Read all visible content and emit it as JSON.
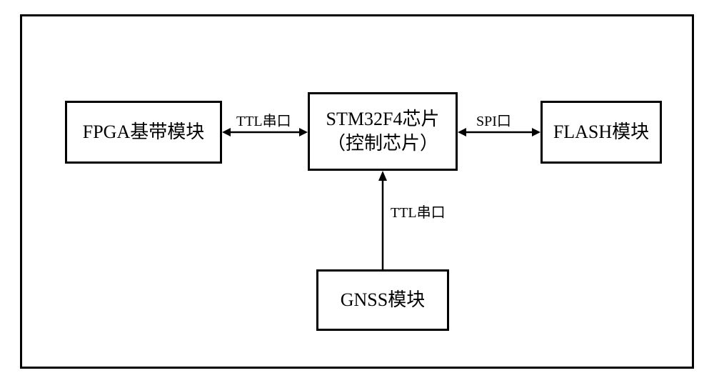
{
  "boxes": {
    "fpga": "FPGA基带模块",
    "mcu_line1": "STM32F4芯片",
    "mcu_line2": "（控制芯片）",
    "flash": "FLASH模块",
    "gnss": "GNSS模块"
  },
  "labels": {
    "link_fpga_mcu": "TTL串口",
    "link_mcu_flash": "SPI口",
    "link_gnss_mcu": "TTL串口"
  }
}
